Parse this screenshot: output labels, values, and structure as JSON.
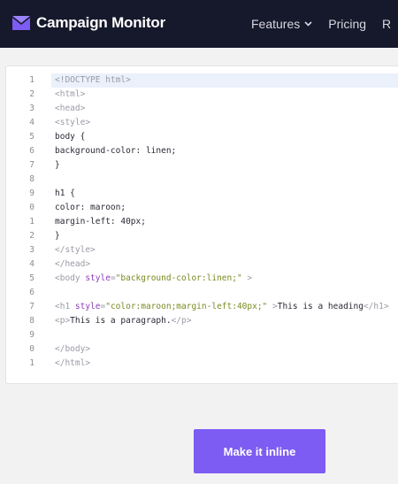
{
  "header": {
    "brand": "Campaign Monitor",
    "brand_icon": "envelope-logo-icon",
    "nav": [
      {
        "label": "Features",
        "has_dropdown": true
      },
      {
        "label": "Pricing"
      },
      {
        "label": "R"
      }
    ]
  },
  "editor": {
    "line_numbers": [
      "1",
      "2",
      "3",
      "4",
      "5",
      "6",
      "7",
      "8",
      "9",
      "0",
      "1",
      "2",
      "3",
      "4",
      "5",
      "6",
      "7",
      "8",
      "9",
      "0",
      "1"
    ],
    "active_line": 1,
    "lines": [
      [
        {
          "t": "<!DOCTYPE html>",
          "c": "tag"
        }
      ],
      [
        {
          "t": "<html>",
          "c": "tag"
        }
      ],
      [
        {
          "t": "<head>",
          "c": "tag"
        }
      ],
      [
        {
          "t": "<style>",
          "c": "tag"
        }
      ],
      [
        {
          "t": "body {",
          "c": "plain"
        }
      ],
      [
        {
          "t": "background-color: linen;",
          "c": "plain"
        }
      ],
      [
        {
          "t": "}",
          "c": "plain"
        }
      ],
      [],
      [
        {
          "t": "h1 {",
          "c": "plain"
        }
      ],
      [
        {
          "t": "color: maroon;",
          "c": "plain"
        }
      ],
      [
        {
          "t": "margin-left: 40px;",
          "c": "plain"
        }
      ],
      [
        {
          "t": "}",
          "c": "plain"
        }
      ],
      [
        {
          "t": "</style>",
          "c": "tag"
        }
      ],
      [
        {
          "t": "</head>",
          "c": "tag"
        }
      ],
      [
        {
          "t": "<body ",
          "c": "tag"
        },
        {
          "t": "style",
          "c": "attr"
        },
        {
          "t": "=",
          "c": "tag"
        },
        {
          "t": "\"background-color:linen;\"",
          "c": "str"
        },
        {
          "t": " >",
          "c": "tag"
        }
      ],
      [],
      [
        {
          "t": "<h1 ",
          "c": "tag"
        },
        {
          "t": "style",
          "c": "attr"
        },
        {
          "t": "=",
          "c": "tag"
        },
        {
          "t": "\"color:maroon;margin-left:40px;\"",
          "c": "str"
        },
        {
          "t": " >",
          "c": "tag"
        },
        {
          "t": "This is a heading",
          "c": "plain"
        },
        {
          "t": "</h1>",
          "c": "tag"
        }
      ],
      [
        {
          "t": "<p>",
          "c": "tag"
        },
        {
          "t": "This is a paragraph.",
          "c": "plain"
        },
        {
          "t": "</p>",
          "c": "tag"
        }
      ],
      [],
      [
        {
          "t": "</body>",
          "c": "tag"
        }
      ],
      [
        {
          "t": "</html>",
          "c": "tag"
        }
      ],
      []
    ]
  },
  "action": {
    "make_inline_label": "Make it inline"
  },
  "colors": {
    "header_bg": "#16182b",
    "accent": "#7c5cf2"
  }
}
